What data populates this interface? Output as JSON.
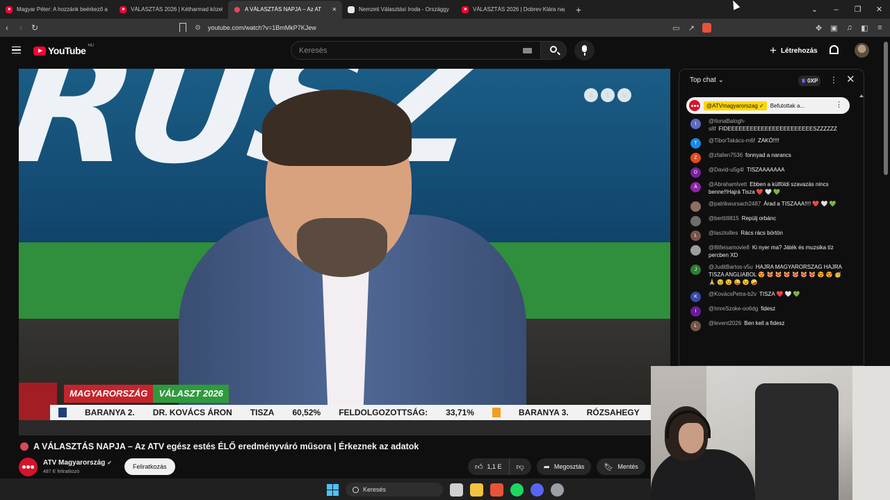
{
  "browser": {
    "tabs": [
      {
        "title": "Magyar Péter: A hozzánk beérkező a",
        "favicon": "youtube-icon",
        "active": false
      },
      {
        "title": "VÁLASZTÁS 2026 | Kétharmad közelé",
        "favicon": "youtube-icon",
        "active": false
      },
      {
        "title": "A VÁLASZTÁS NAPJA – Az AT",
        "favicon": "recording-icon",
        "active": true
      },
      {
        "title": "Nemzeti Választási Iroda - Országgy",
        "favicon": "document-icon",
        "active": false
      },
      {
        "title": "VÁLASZTÁS 2026 | Dobrev Klára nagy",
        "favicon": "youtube-icon",
        "active": false
      }
    ],
    "tab_close": "×",
    "new_tab": "+",
    "url": "youtube.com/watch?v=1BmMkP7KJew"
  },
  "youtube": {
    "logo_text": "YouTube",
    "country_code": "HU",
    "search_placeholder": "Keresés",
    "create_label": "Létrehozás"
  },
  "video": {
    "top_letters": "RUSZ",
    "overlay_buttons": [
      "a",
      "t",
      "v"
    ],
    "lower_third": {
      "brand_left": "MAGYARORSZÁG",
      "brand_right": "VÁLASZT 2026",
      "ticker": [
        "BARANYA 2.",
        "DR. KOVÁCS ÁRON",
        "TISZA",
        "60,52%",
        "FELDOLGOZOTTSÁG:",
        "33,71%",
        "BARANYA 3.",
        "RÓZSAHEGY"
      ]
    },
    "title": "A VÁLASZTÁS NAPJA – Az ATV egész estés ÉLŐ eredményváró műsora | Érkeznek az adatok",
    "channel_name": "ATV Magyarország",
    "verified_mark": "✔",
    "subscribers": "487 E feliratkozó",
    "subscribe_label": "Feliratkozás",
    "likes": "1,1 E",
    "share_label": "Megosztás",
    "save_label": "Mentés"
  },
  "chat": {
    "header": "Top chat",
    "xp": "0XP",
    "pinned": {
      "author": "@ATVmagyarorszag ✓",
      "text": "Befutottak a..."
    },
    "messages": [
      {
        "initial": "I",
        "color": "#5c6bc0",
        "author": "@IlonaBalogh-s8f",
        "text": "FIDEEEEEEEEEEEEEEEEEEEEEEESZZZZZZ"
      },
      {
        "initial": "T",
        "color": "#1e88e5",
        "author": "@TiborTakács-m6f",
        "text": "ZAKÓ!!!!"
      },
      {
        "initial": "Z",
        "color": "#e64a19",
        "author": "@zfallen7536",
        "text": "fonnyad a narancs"
      },
      {
        "initial": "D",
        "color": "#7b1fa2",
        "author": "@David-u5g4l",
        "text": "TISZAAAAAAA"
      },
      {
        "initial": "Á",
        "color": "#8e24aa",
        "author": "@Abrahamlvett",
        "text": "Ebben a külföldi szavazás nincs benne!!Hajrá Tisza ❤️ 🤍 💚"
      },
      {
        "initial": "",
        "color": "#8d6e63",
        "author": "@patrikwursach2487",
        "text": "Árad a TISZAAA!!!! ❤️ 🤍 💚"
      },
      {
        "initial": "",
        "color": "#6d6d6d",
        "author": "@bertti9815",
        "text": "Repülj orbánc"
      },
      {
        "initial": "L",
        "color": "#795548",
        "author": "@laszloilles",
        "text": "Rács rács börtön"
      },
      {
        "initial": "",
        "color": "#9e9e9e",
        "author": "@8lifeisamovie8",
        "text": "Ki nyer ma? Játék és muzsika tíz percben XD"
      },
      {
        "initial": "J",
        "color": "#2e7d32",
        "author": "@JuditBartos-v5u",
        "text": "HAJRA MAGYARORSZAG HAJRA TISZA ANGLIABOL 😍 😻 😻 😻 😻 😻 😻 😍 😍 🥳 🙏 🥹 😉 😜 😉 🤪"
      },
      {
        "initial": "K",
        "color": "#3949ab",
        "author": "@KovácsPetra-b2v",
        "text": "TISZA ❤️ 🤍 💚"
      },
      {
        "initial": "I",
        "color": "#6a1b9a",
        "author": "@ImreSzoke-oo6dg",
        "text": "fidesz"
      },
      {
        "initial": "L",
        "color": "#795548",
        "author": "@levent2026",
        "text": "Ben kell a fidesz"
      }
    ]
  },
  "taskbar": {
    "search_label": "Keresés",
    "apps": [
      {
        "name": "task-view-icon",
        "color": "#d0d0d0"
      },
      {
        "name": "file-explorer-icon",
        "color": "#f3c33f"
      },
      {
        "name": "brave-icon",
        "color": "#e8533a"
      },
      {
        "name": "spotify-icon",
        "color": "#1ed760"
      },
      {
        "name": "discord-icon",
        "color": "#5865f2"
      },
      {
        "name": "settings-icon",
        "color": "#9aa0a6"
      }
    ]
  }
}
